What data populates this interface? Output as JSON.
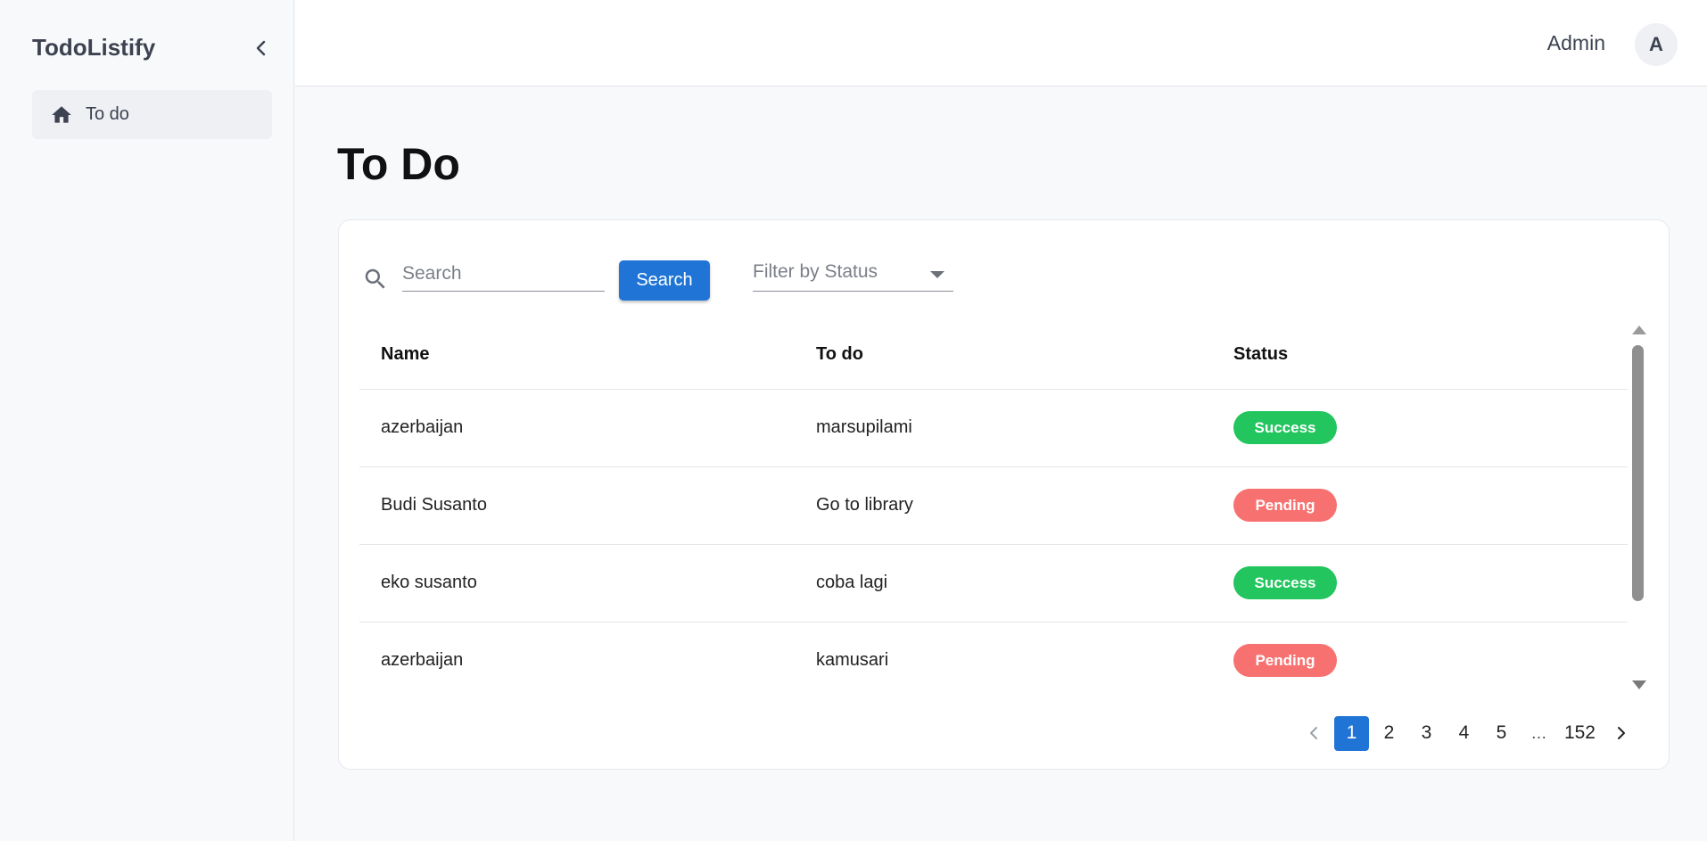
{
  "app": {
    "title": "TodoListify"
  },
  "sidebar": {
    "items": [
      {
        "label": "To do",
        "icon": "home-icon"
      }
    ]
  },
  "header": {
    "user_name": "Admin",
    "avatar_initial": "A"
  },
  "main": {
    "title": "To Do",
    "search": {
      "placeholder": "Search",
      "value": "",
      "button_label": "Search"
    },
    "filter": {
      "placeholder": "Filter by Status"
    },
    "table": {
      "columns": [
        "Name",
        "To do",
        "Status"
      ],
      "rows": [
        {
          "name": "azerbaijan",
          "todo": "marsupilami",
          "status": "Success"
        },
        {
          "name": "Budi Susanto",
          "todo": "Go to library",
          "status": "Pending"
        },
        {
          "name": "eko susanto",
          "todo": "coba lagi",
          "status": "Success"
        },
        {
          "name": "azerbaijan",
          "todo": "kamusari",
          "status": "Pending"
        }
      ]
    },
    "status_colors": {
      "Success": "#22c55e",
      "Pending": "#f87171"
    },
    "pagination": {
      "current": "1",
      "pages": [
        "1",
        "2",
        "3",
        "4",
        "5"
      ],
      "ellipsis": "…",
      "last": "152"
    }
  },
  "colors": {
    "accent": "#1f74d6"
  }
}
